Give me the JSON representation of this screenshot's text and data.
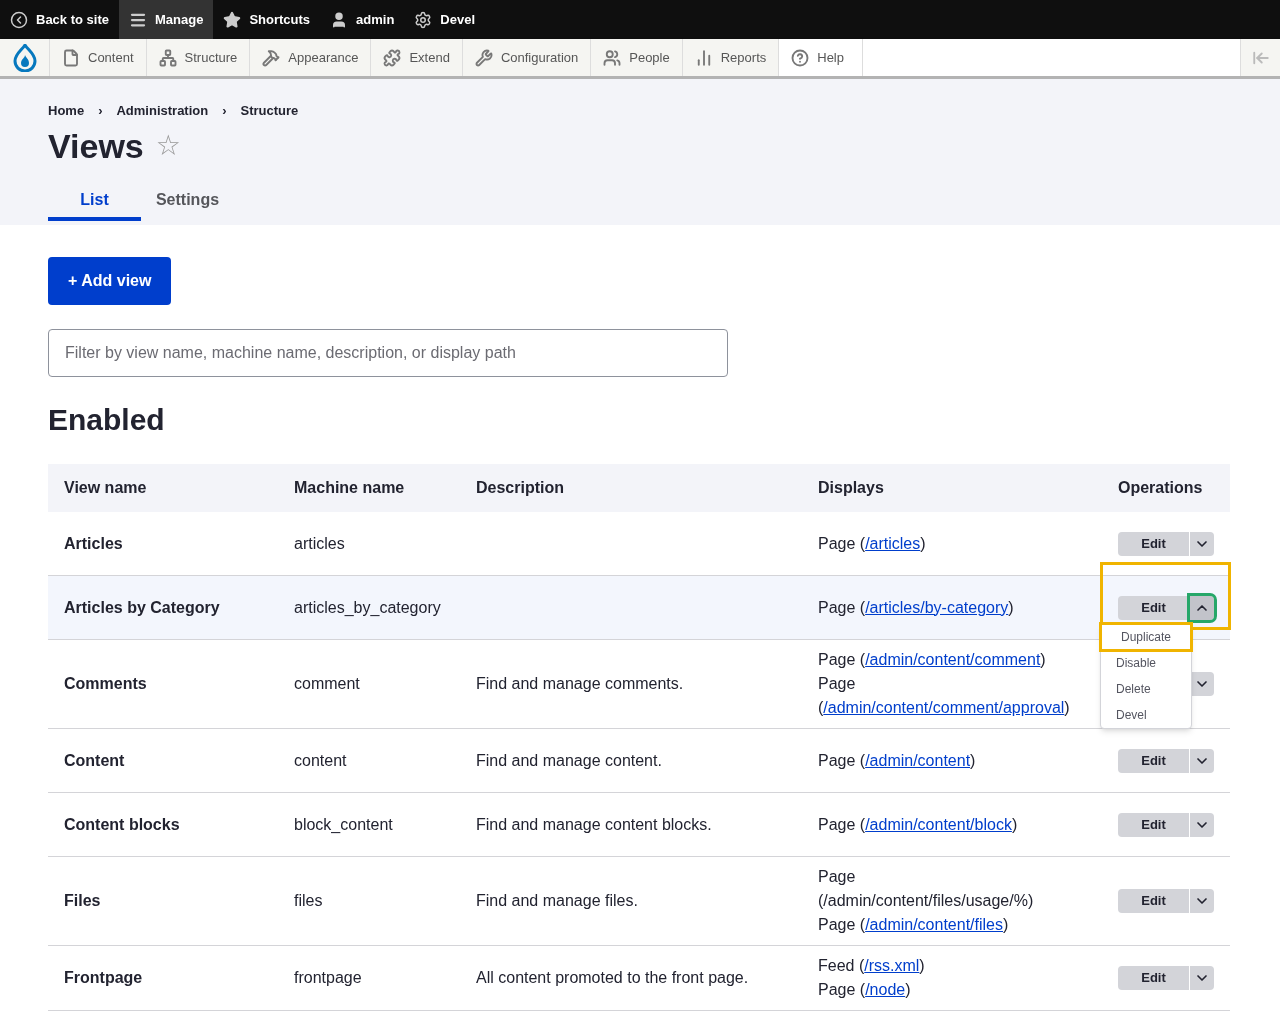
{
  "top_bar": {
    "items": [
      {
        "kind": "back",
        "label": "Back to site",
        "selected": false
      },
      {
        "kind": "manage",
        "label": "Manage",
        "selected": true
      },
      {
        "kind": "star",
        "label": "Shortcuts",
        "selected": false
      },
      {
        "kind": "user",
        "label": "admin",
        "selected": false
      },
      {
        "kind": "gear",
        "label": "Devel",
        "selected": false
      }
    ]
  },
  "admin_menu": {
    "items": [
      {
        "kind": "file",
        "label": "Content"
      },
      {
        "kind": "tree",
        "label": "Structure"
      },
      {
        "kind": "hammer",
        "label": "Appearance"
      },
      {
        "kind": "puzzle",
        "label": "Extend"
      },
      {
        "kind": "wrench",
        "label": "Configuration"
      },
      {
        "kind": "people",
        "label": "People"
      },
      {
        "kind": "bars",
        "label": "Reports"
      },
      {
        "kind": "help",
        "label": "Help"
      }
    ]
  },
  "breadcrumb": [
    {
      "label": "Home",
      "separator": "›"
    },
    {
      "label": "Administration",
      "separator": "›"
    },
    {
      "label": "Structure"
    }
  ],
  "page_title": "Views",
  "shortcut_star": "☆",
  "tabs": [
    {
      "label": "List",
      "selected": true
    },
    {
      "label": "Settings",
      "selected": false
    }
  ],
  "add_button": "+ Add view",
  "filter": {
    "placeholder": "Filter by view name, machine name, description, or display path"
  },
  "section_title": "Enabled",
  "table": {
    "columns": [
      "View name",
      "Machine name",
      "Description",
      "Displays",
      "Operations"
    ],
    "rows": [
      {
        "name": "Articles",
        "machine": "articles",
        "description": "",
        "selected": false,
        "displays": [
          {
            "before": "Page (",
            "link": "/articles",
            "after": ")"
          }
        ],
        "operations": {
          "edit": "Edit",
          "expanded": false
        }
      },
      {
        "name": "Articles by Category",
        "machine": "articles_by_category",
        "description": "",
        "selected": true,
        "displays": [
          {
            "before": "Page (",
            "link": "/articles/by-category",
            "after": ")"
          }
        ],
        "operations": {
          "edit": "Edit",
          "expanded": true,
          "menu": [
            "Duplicate",
            "Disable",
            "Delete",
            "Devel"
          ]
        }
      },
      {
        "name": "Comments",
        "machine": "comment",
        "description": "Find and manage comments.",
        "selected": false,
        "displays": [
          {
            "before": "Page (",
            "link": "/admin/content/comment",
            "after": ")"
          },
          {
            "before": "Page (",
            "link": "/admin/content/comment/approval",
            "after": ")"
          }
        ],
        "operations": {
          "expanded": false
        }
      },
      {
        "name": "Content",
        "machine": "content",
        "description": "Find and manage content.",
        "selected": false,
        "displays": [
          {
            "before": "Page (",
            "link": "/admin/content",
            "after": ")"
          }
        ],
        "operations": {
          "edit": "Edit",
          "expanded": false
        }
      },
      {
        "name": "Content blocks",
        "machine": "block_content",
        "description": "Find and manage content blocks.",
        "selected": false,
        "displays": [
          {
            "before": "Page (",
            "link": "/admin/content/block",
            "after": ")"
          }
        ],
        "operations": {
          "edit": "Edit",
          "expanded": false
        }
      },
      {
        "name": "Files",
        "machine": "files",
        "description": "Find and manage files.",
        "selected": false,
        "displays": [
          {
            "before": "Page (/admin/content/files/usage/%)"
          },
          {
            "before": "Page (",
            "link": "/admin/content/files",
            "after": ")"
          }
        ],
        "operations": {
          "edit": "Edit",
          "expanded": false
        }
      },
      {
        "name": "Frontpage",
        "machine": "frontpage",
        "description": "All content promoted to the front page.",
        "selected": false,
        "displays": [
          {
            "before": "Feed (",
            "link": "/rss.xml",
            "after": ")"
          },
          {
            "before": "Page (",
            "link": "/node",
            "after": ")"
          }
        ],
        "operations": {
          "edit": "Edit",
          "expanded": false
        }
      }
    ]
  }
}
